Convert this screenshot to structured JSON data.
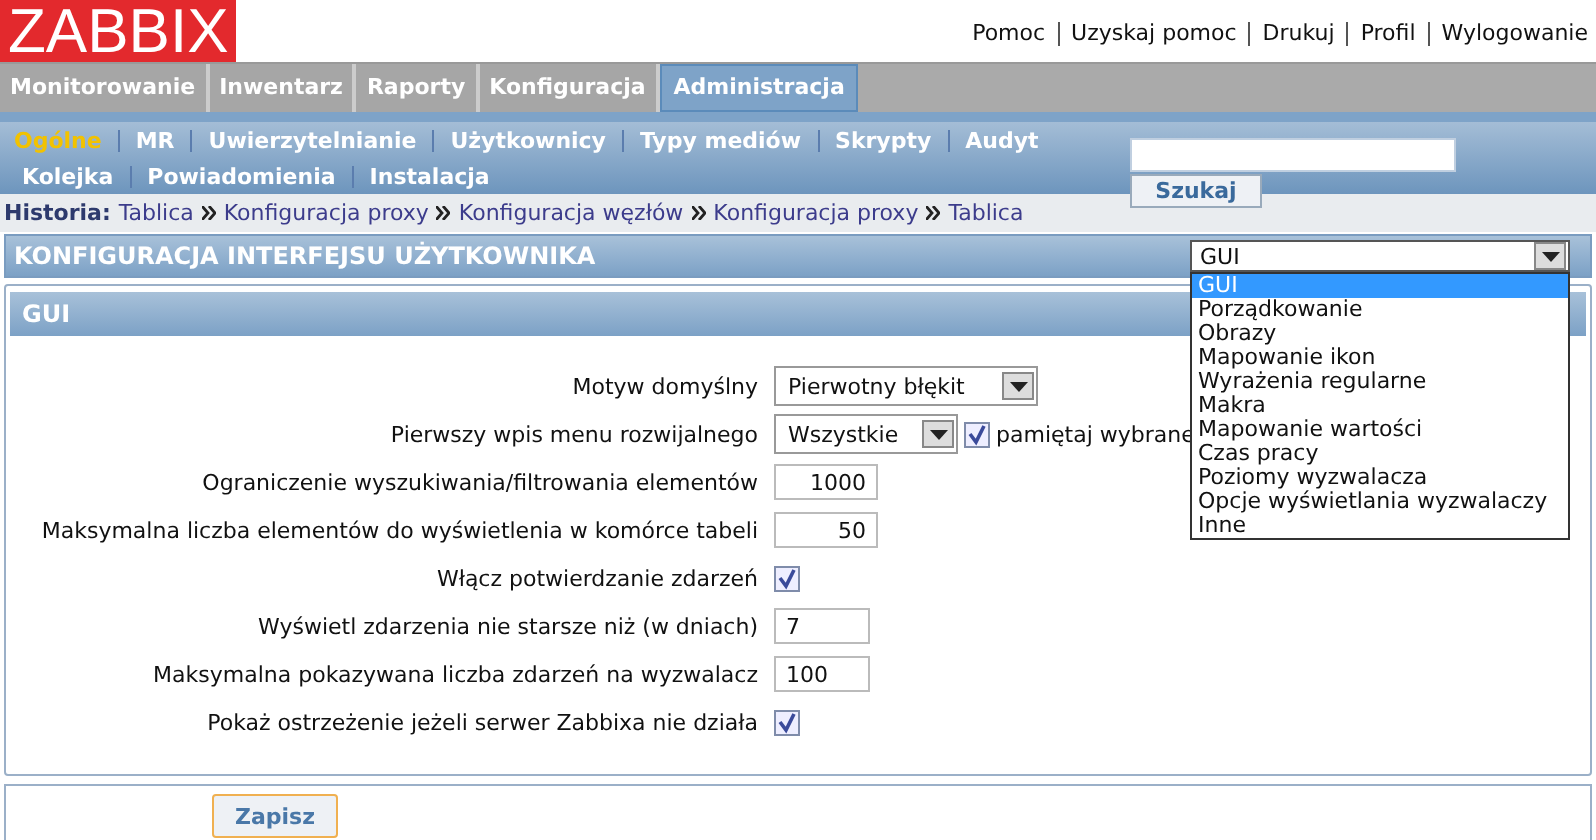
{
  "logo": "ZABBIX",
  "top_links": [
    "Pomoc",
    "Uzyskaj pomoc",
    "Drukuj",
    "Profil",
    "Wylogowanie"
  ],
  "main_menu": [
    {
      "label": "Monitorowanie",
      "selected": false
    },
    {
      "label": "Inwentarz",
      "selected": false
    },
    {
      "label": "Raporty",
      "selected": false
    },
    {
      "label": "Konfiguracja",
      "selected": false
    },
    {
      "label": "Administracja",
      "selected": true
    }
  ],
  "sub_menu": [
    [
      {
        "label": "Ogólne",
        "selected": true
      },
      {
        "label": "MR",
        "selected": false
      },
      {
        "label": "Uwierzytelnianie",
        "selected": false
      },
      {
        "label": "Użytkownicy",
        "selected": false
      },
      {
        "label": "Typy mediów",
        "selected": false
      },
      {
        "label": "Skrypty",
        "selected": false
      },
      {
        "label": "Audyt",
        "selected": false
      }
    ],
    [
      {
        "label": "Kolejka",
        "selected": false
      },
      {
        "label": "Powiadomienia",
        "selected": false
      },
      {
        "label": "Instalacja",
        "selected": false
      }
    ]
  ],
  "search": {
    "button": "Szukaj"
  },
  "history": {
    "label": "Historia:",
    "items": [
      "Tablica",
      "Konfiguracja proxy",
      "Konfiguracja węzłów",
      "Konfiguracja proxy",
      "Tablica"
    ]
  },
  "section_title": "KONFIGURACJA INTERFEJSU UŻYTKOWNIKA",
  "section_select": {
    "value": "GUI",
    "options": [
      {
        "label": "GUI",
        "selected": true
      },
      {
        "label": "Porządkowanie",
        "selected": false
      },
      {
        "label": "Obrazy",
        "selected": false
      },
      {
        "label": "Mapowanie ikon",
        "selected": false
      },
      {
        "label": "Wyrażenia regularne",
        "selected": false
      },
      {
        "label": "Makra",
        "selected": false
      },
      {
        "label": "Mapowanie wartości",
        "selected": false
      },
      {
        "label": "Czas pracy",
        "selected": false
      },
      {
        "label": "Poziomy wyzwalacza",
        "selected": false
      },
      {
        "label": "Opcje wyświetlania wyzwalaczy",
        "selected": false
      },
      {
        "label": "Inne",
        "selected": false
      }
    ]
  },
  "panel_title": "GUI",
  "form_rows": [
    {
      "kind": "select",
      "label": "Motyw domyślny",
      "value": "Pierwotny błękit"
    },
    {
      "kind": "select_check",
      "label": "Pierwszy wpis menu rozwijalnego",
      "value": "Wszystkie",
      "checked": true,
      "check_label": "pamiętaj wybrane"
    },
    {
      "kind": "number",
      "label": "Ograniczenie wyszukiwania/filtrowania elementów",
      "value": "1000"
    },
    {
      "kind": "number",
      "label": "Maksymalna liczba elementów do wyświetlenia w komórce tabeli",
      "value": "50"
    },
    {
      "kind": "checkbox",
      "label": "Włącz potwierdzanie zdarzeń",
      "checked": true
    },
    {
      "kind": "text",
      "label": "Wyświetl zdarzenia nie starsze niż (w dniach)",
      "value": "7"
    },
    {
      "kind": "text",
      "label": "Maksymalna pokazywana liczba zdarzeń na wyzwalacz",
      "value": "100"
    },
    {
      "kind": "checkbox",
      "label": "Pokaż ostrzeżenie jeżeli serwer Zabbixa nie działa",
      "checked": true
    }
  ],
  "save_button": "Zapisz"
}
